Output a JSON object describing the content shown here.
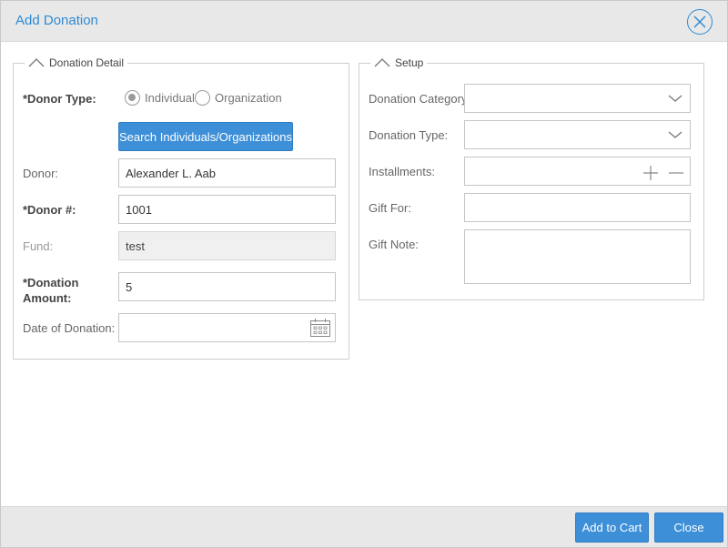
{
  "dialog": {
    "title": "Add Donation"
  },
  "donation_detail": {
    "legend": "Donation Detail",
    "donor_type_label": "*Donor Type:",
    "radio_individual": "Individual",
    "radio_organization": "Organization",
    "selected_type": "Individual",
    "search_button": "Search Individuals/Organizations",
    "donor_label": "Donor:",
    "donor_value": "Alexander L. Aab",
    "donor_num_label": "*Donor #:",
    "donor_num_value": "1001",
    "fund_label": "Fund:",
    "fund_value": "test",
    "amount_label_line1": "*Donation",
    "amount_label_line2": "Amount:",
    "amount_value": "5",
    "date_label": "Date of Donation:",
    "date_value": ""
  },
  "setup": {
    "legend": "Setup",
    "category_label": "Donation Category:",
    "category_value": "",
    "type_label": "Donation Type:",
    "type_value": "",
    "installments_label": "Installments:",
    "installments_value": "",
    "gift_for_label": "Gift For:",
    "gift_for_value": "",
    "gift_note_label": "Gift Note:",
    "gift_note_value": ""
  },
  "footer": {
    "add_to_cart": "Add to Cart",
    "close": "Close"
  },
  "colors": {
    "accent": "#2e8bd3",
    "button": "#3d8fd8",
    "bar": "#e8e8e8"
  },
  "icons": [
    "close-circle-icon",
    "chevron-up-icon",
    "chevron-down-icon",
    "plus-icon",
    "minus-icon",
    "calendar-icon"
  ]
}
